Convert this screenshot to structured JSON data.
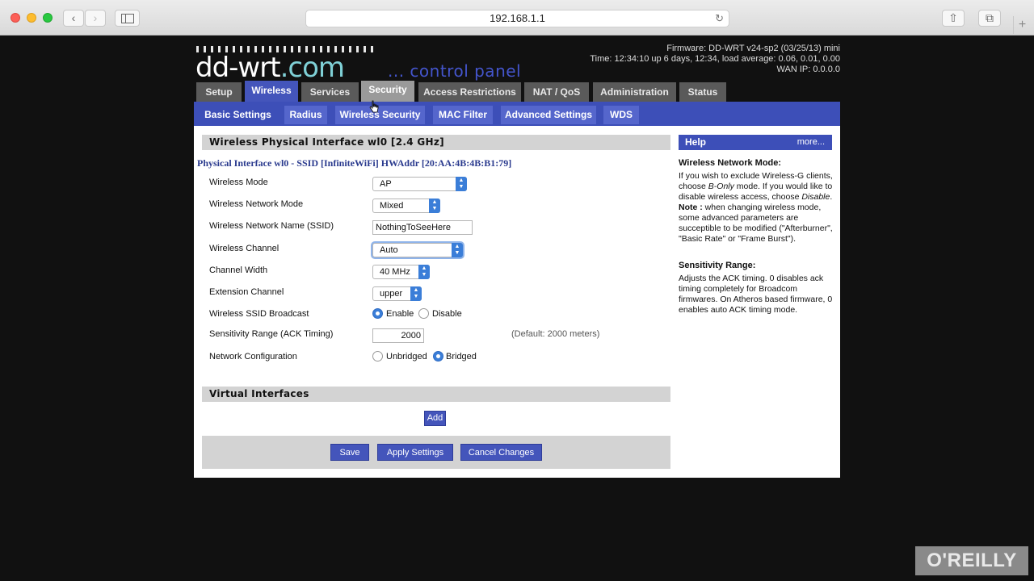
{
  "browser": {
    "url": "192.168.1.1",
    "back": "‹",
    "forward": "›",
    "reload": "↻",
    "share": "⇧",
    "tabs": "⧉",
    "plus": "+"
  },
  "header": {
    "logo_main": "dd-wrt",
    "logo_tld": ".com",
    "control_panel": "... control panel",
    "firmware": "Firmware: DD-WRT v24-sp2 (03/25/13) mini",
    "time": "Time: 12:34:10 up 6 days, 12:34, load average: 0.06, 0.01, 0.00",
    "wan_ip": "WAN IP: 0.0.0.0"
  },
  "main_tabs": [
    "Setup",
    "Wireless",
    "Services",
    "Security",
    "Access Restrictions",
    "NAT / QoS",
    "Administration",
    "Status"
  ],
  "sub_tabs": [
    "Basic Settings",
    "Radius",
    "Wireless Security",
    "MAC Filter",
    "Advanced Settings",
    "WDS"
  ],
  "section": {
    "title": "Wireless Physical Interface wl0 [2.4 GHz]",
    "physical_interface": "Physical Interface wl0 - SSID [InfiniteWiFi] HWAddr [20:AA:4B:4B:B1:79]"
  },
  "fields": {
    "wireless_mode_label": "Wireless Mode",
    "wireless_mode_value": "AP",
    "network_mode_label": "Wireless Network Mode",
    "network_mode_value": "Mixed",
    "ssid_label": "Wireless Network Name (SSID)",
    "ssid_value": "NothingToSeeHere",
    "channel_label": "Wireless Channel",
    "channel_value": "Auto",
    "width_label": "Channel Width",
    "width_value": "40 MHz",
    "ext_label": "Extension Channel",
    "ext_value": "upper",
    "broadcast_label": "Wireless SSID Broadcast",
    "enable": "Enable",
    "disable": "Disable",
    "sensitivity_label": "Sensitivity Range (ACK Timing)",
    "sensitivity_value": "2000",
    "sensitivity_default": "(Default: 2000 meters)",
    "netconf_label": "Network Configuration",
    "unbridged": "Unbridged",
    "bridged": "Bridged"
  },
  "virtual": {
    "title": "Virtual Interfaces",
    "add": "Add"
  },
  "buttons": {
    "save": "Save",
    "apply": "Apply Settings",
    "cancel": "Cancel Changes"
  },
  "help": {
    "title": "Help",
    "more": "more...",
    "h1": "Wireless Network Mode:",
    "p1_a": "If you wish to exclude Wireless-G clients, choose ",
    "p1_b": "B-Only",
    "p1_c": " mode. If you would like to disable wireless access, choose ",
    "p1_d": "Disable",
    "p1_e": ".",
    "note_label": "Note :",
    "note_text": " when changing wireless mode, some advanced parameters are succeptible to be modified (\"Afterburner\", \"Basic Rate\" or \"Frame Burst\").",
    "h2": "Sensitivity Range:",
    "p2": "Adjusts the ACK timing. 0 disables ack timing completely for Broadcom firmwares. On Atheros based firmware, 0 enables auto ACK timing mode."
  },
  "watermark": "O'REILLY"
}
